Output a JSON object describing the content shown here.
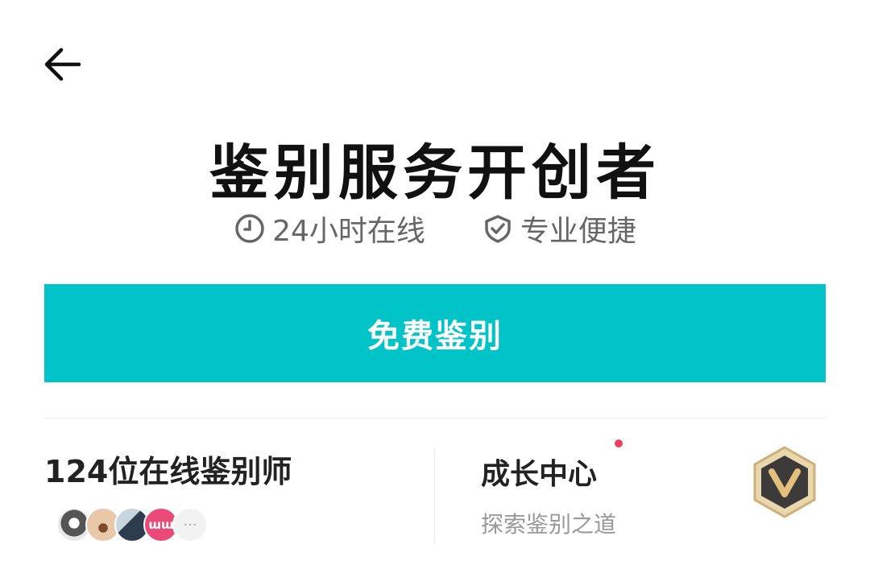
{
  "title": "鉴别服务开创者",
  "features": [
    {
      "icon": "clock-icon",
      "label": "24小时在线"
    },
    {
      "icon": "shield-check-icon",
      "label": "专业便捷"
    }
  ],
  "cta": {
    "label": "免费鉴别"
  },
  "online": {
    "title": "124位在线鉴别师",
    "avatars": [
      "avatar",
      "avatar",
      "avatar",
      "avatar",
      "more"
    ],
    "avatar4_text": "ɯɯ",
    "more_text": "···"
  },
  "growth": {
    "title": "成长中心",
    "subtitle": "探索鉴别之道",
    "badge_letter": "V"
  },
  "colors": {
    "accent": "#00c4c8",
    "dot": "#f0405c",
    "badge_gold": "#d9b97a",
    "badge_dark": "#3d3a3a"
  }
}
